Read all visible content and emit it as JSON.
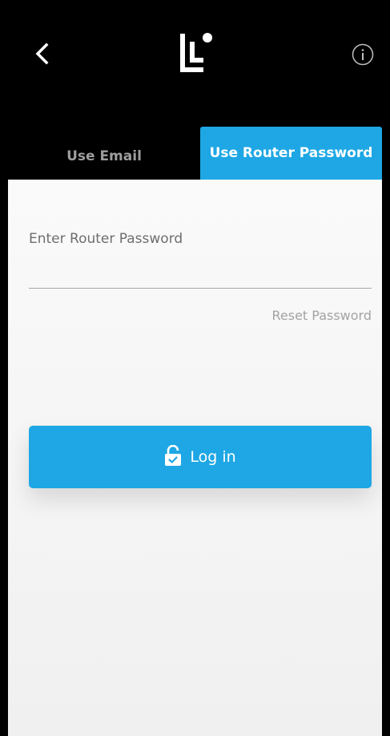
{
  "header": {
    "back_icon": "chevron-left-icon",
    "logo_icon": "linksys-logo-icon",
    "info_icon": "info-circle-icon"
  },
  "tabs": [
    {
      "label": "Use Email",
      "active": false
    },
    {
      "label": "Use Router Password",
      "active": true
    }
  ],
  "form": {
    "password_label": "Enter Router Password",
    "password_value": "",
    "reset_link": "Reset Password",
    "login_label": "Log in",
    "login_icon": "lock-icon"
  },
  "colors": {
    "accent": "#1ea7e4",
    "header_bg": "#000000",
    "content_bg": "#f5f5f5"
  }
}
